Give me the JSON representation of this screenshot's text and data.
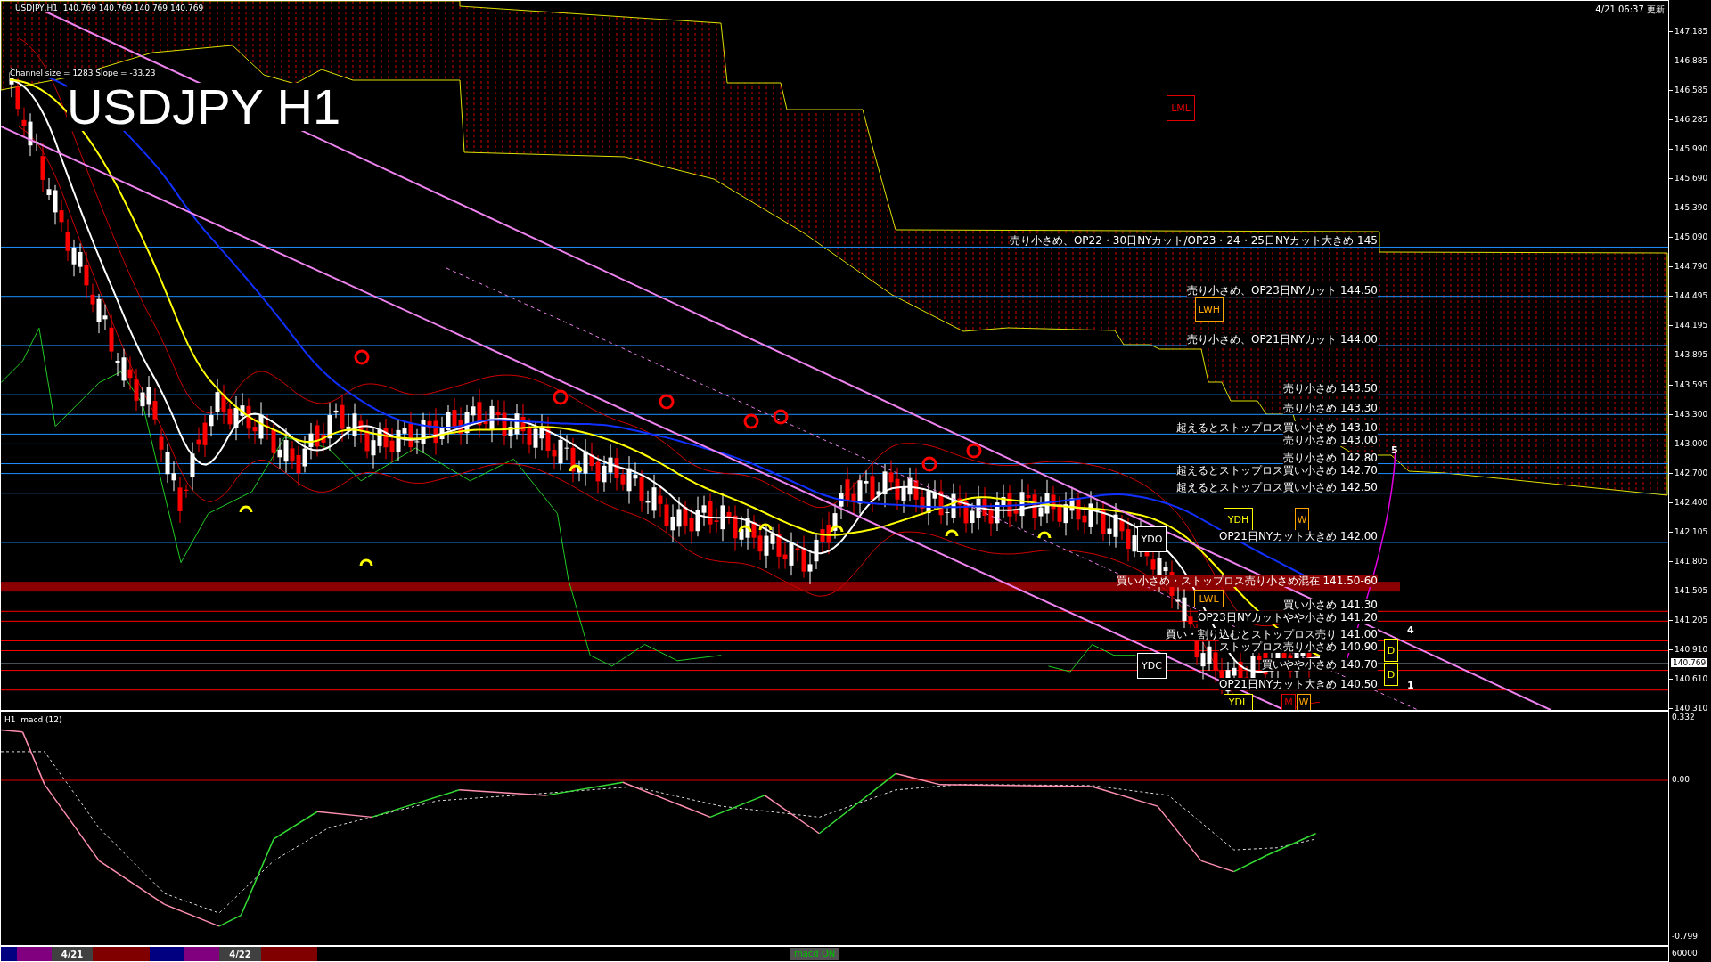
{
  "header": {
    "quote": "USDJPY,H1  140.769 140.769 140.769 140.769",
    "timestamp": "4/21 06:37 更新"
  },
  "chart": {
    "channel_info": "Channel size = 1283 Slope = -33.23",
    "title": "USDJPY H1",
    "levels": [
      {
        "text": "売り小さめ、OP22・30日NYカット/OP23・24・25日NYカット大きめ 145",
        "kind": "sell"
      },
      {
        "text": "売り小さめ、OP23日NYカット 144.50",
        "kind": "sell"
      },
      {
        "text": "売り小さめ、OP21日NYカット 144.00",
        "kind": "sell"
      },
      {
        "text": "売り小さめ 143.50",
        "kind": "sell"
      },
      {
        "text": "売り小さめ 143.30",
        "kind": "sell"
      },
      {
        "text": "超えるとストップロス買い小さめ 143.10",
        "kind": "sell"
      },
      {
        "text": "売り小さめ 143.00",
        "kind": "sell"
      },
      {
        "text": "売り小さめ 142.80",
        "kind": "sell"
      },
      {
        "text": "超えるとストップロス買い小さめ 142.70",
        "kind": "sell"
      },
      {
        "text": "超えるとストップロス買い小さめ 142.50",
        "kind": "sell"
      },
      {
        "text": "OP21日NYカット大きめ 142.00",
        "kind": "sell"
      },
      {
        "text": "買い小さめ・ストップロス売り小さめ混在 141.50-60",
        "kind": "band"
      },
      {
        "text": "買い小さめ 141.30",
        "kind": "buy"
      },
      {
        "text": "OP23日NYカットやや小さめ 141.20",
        "kind": "buy"
      },
      {
        "text": "買い・割り込むとストップロス売り 141.00",
        "kind": "buy"
      },
      {
        "text": "ストップロス売り小さめ 140.90",
        "kind": "buy"
      },
      {
        "text": "買いやや小さめ 140.70",
        "kind": "buy"
      },
      {
        "text": "OP21日NYカット大きめ 140.50",
        "kind": "buy"
      }
    ],
    "markers": [
      {
        "text": "LML",
        "color": "#e00000"
      },
      {
        "text": "LWH",
        "color": "#ffa500"
      },
      {
        "text": "YDH",
        "color": "#ffff00"
      },
      {
        "text": "W",
        "color": "#ffa500"
      },
      {
        "text": "YDO",
        "color": "#ffffff"
      },
      {
        "text": "LWL",
        "color": "#ffa500"
      },
      {
        "text": "YDC",
        "color": "#ffffff"
      },
      {
        "text": "D",
        "color": "#ffff00"
      },
      {
        "text": "D",
        "color": "#ffff00"
      },
      {
        "text": "YDL",
        "color": "#ffff00"
      },
      {
        "text": "M",
        "color": "#e00000"
      },
      {
        "text": "W",
        "color": "#ffa500"
      }
    ],
    "wave_labels": [
      "5",
      "4",
      "1"
    ],
    "price_axis": [
      "147.185",
      "146.885",
      "146.585",
      "146.285",
      "145.990",
      "145.690",
      "145.390",
      "145.090",
      "144.790",
      "144.495",
      "144.195",
      "143.895",
      "143.595",
      "143.300",
      "143.000",
      "142.700",
      "142.400",
      "142.105",
      "141.805",
      "141.505",
      "141.205",
      "140.910",
      "140.610",
      "140.310"
    ],
    "current_price": "140.769"
  },
  "macd": {
    "title": "H1  macd (12)",
    "axis": [
      "0.332",
      "0.00",
      "-0.799"
    ]
  },
  "volume": {
    "axis": "60000"
  },
  "session_strip": [
    {
      "color": "#000080"
    },
    {
      "color": "#800080"
    },
    {
      "color": "#404040",
      "label": "4/21"
    },
    {
      "color": "#800000"
    },
    {
      "color": "#000080"
    },
    {
      "color": "#800080"
    },
    {
      "color": "#404040",
      "label": "4/22"
    },
    {
      "color": "#800000"
    }
  ],
  "toggle": {
    "label": "macd ON"
  }
}
